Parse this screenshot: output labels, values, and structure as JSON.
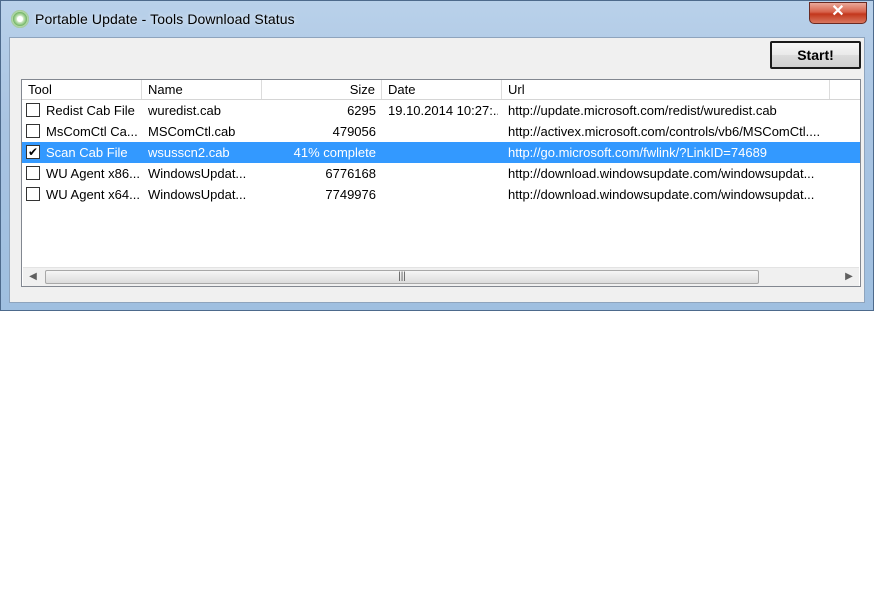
{
  "window": {
    "title": "Portable Update - Tools Download Status",
    "close_label": "✕"
  },
  "toolbar": {
    "start_label": "Start!"
  },
  "table": {
    "columns": [
      "Tool",
      "Name",
      "Size",
      "Date",
      "Url"
    ],
    "rows": [
      {
        "checked": false,
        "tool": "Redist Cab File",
        "name": "wuredist.cab",
        "size": "6295",
        "date": "19.10.2014 10:27:...",
        "url": "http://update.microsoft.com/redist/wuredist.cab",
        "selected": false
      },
      {
        "checked": false,
        "tool": "MsComCtl Ca...",
        "name": "MSComCtl.cab",
        "size": "479056",
        "date": "",
        "url": "http://activex.microsoft.com/controls/vb6/MSComCtl....",
        "selected": false
      },
      {
        "checked": true,
        "tool": "Scan Cab File",
        "name": "wsusscn2.cab",
        "size": "41% complete",
        "date": "",
        "url": "http://go.microsoft.com/fwlink/?LinkID=74689",
        "selected": true
      },
      {
        "checked": false,
        "tool": "WU Agent x86...",
        "name": "WindowsUpdat...",
        "size": "6776168",
        "date": "",
        "url": "http://download.windowsupdate.com/windowsupdat...",
        "selected": false
      },
      {
        "checked": false,
        "tool": "WU Agent x64...",
        "name": "WindowsUpdat...",
        "size": "7749976",
        "date": "",
        "url": "http://download.windowsupdate.com/windowsupdat...",
        "selected": false
      }
    ]
  },
  "scrollbar": {
    "left_arrow": "◀",
    "right_arrow": "▶",
    "grip": "|||"
  },
  "colors": {
    "selection": "#3399ff",
    "close": "#c3371c"
  }
}
